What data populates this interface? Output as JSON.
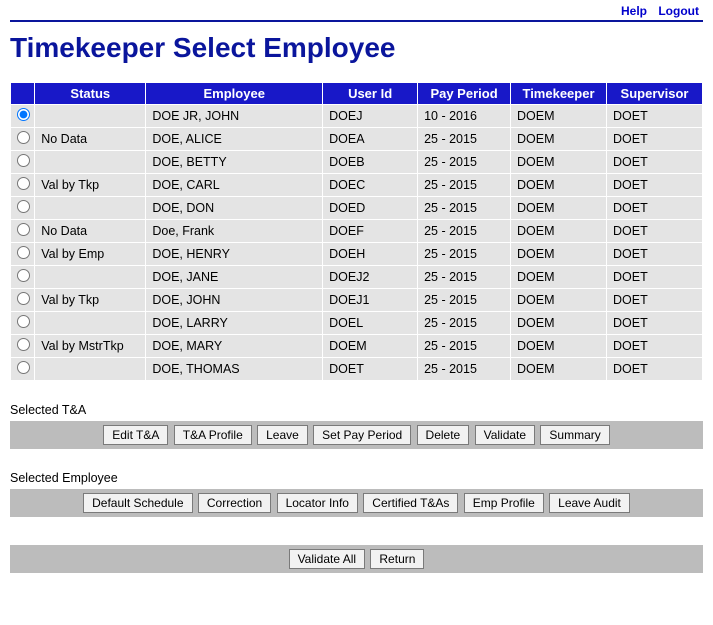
{
  "topLinks": {
    "help": "Help",
    "logout": "Logout"
  },
  "title": "Timekeeper Select Employee",
  "columns": [
    "Status",
    "Employee",
    "User Id",
    "Pay Period",
    "Timekeeper",
    "Supervisor"
  ],
  "rows": [
    {
      "selected": true,
      "status": "",
      "employee": "DOE JR, JOHN",
      "userId": "DOEJ",
      "payPeriod": "10 - 2016",
      "timekeeper": "DOEM",
      "supervisor": "DOET"
    },
    {
      "selected": false,
      "status": "No Data",
      "employee": "DOE, ALICE",
      "userId": "DOEA",
      "payPeriod": "25 - 2015",
      "timekeeper": "DOEM",
      "supervisor": "DOET"
    },
    {
      "selected": false,
      "status": "",
      "employee": "DOE, BETTY",
      "userId": "DOEB",
      "payPeriod": "25 - 2015",
      "timekeeper": "DOEM",
      "supervisor": "DOET"
    },
    {
      "selected": false,
      "status": "Val by Tkp",
      "employee": "DOE, CARL",
      "userId": "DOEC",
      "payPeriod": "25 - 2015",
      "timekeeper": "DOEM",
      "supervisor": "DOET"
    },
    {
      "selected": false,
      "status": "",
      "employee": "DOE, DON",
      "userId": "DOED",
      "payPeriod": "25 - 2015",
      "timekeeper": "DOEM",
      "supervisor": "DOET"
    },
    {
      "selected": false,
      "status": "No Data",
      "employee": "Doe, Frank",
      "userId": "DOEF",
      "payPeriod": "25 - 2015",
      "timekeeper": "DOEM",
      "supervisor": "DOET"
    },
    {
      "selected": false,
      "status": "Val by Emp",
      "employee": "DOE, HENRY",
      "userId": "DOEH",
      "payPeriod": "25 - 2015",
      "timekeeper": "DOEM",
      "supervisor": "DOET"
    },
    {
      "selected": false,
      "status": "",
      "employee": "DOE, JANE",
      "userId": "DOEJ2",
      "payPeriod": "25 - 2015",
      "timekeeper": "DOEM",
      "supervisor": "DOET"
    },
    {
      "selected": false,
      "status": "Val by Tkp",
      "employee": "DOE, JOHN",
      "userId": "DOEJ1",
      "payPeriod": "25 - 2015",
      "timekeeper": "DOEM",
      "supervisor": "DOET"
    },
    {
      "selected": false,
      "status": "",
      "employee": "DOE, LARRY",
      "userId": "DOEL",
      "payPeriod": "25 - 2015",
      "timekeeper": "DOEM",
      "supervisor": "DOET"
    },
    {
      "selected": false,
      "status": "Val by MstrTkp",
      "employee": "DOE, MARY",
      "userId": "DOEM",
      "payPeriod": "25 - 2015",
      "timekeeper": "DOEM",
      "supervisor": "DOET"
    },
    {
      "selected": false,
      "status": "",
      "employee": "DOE, THOMAS",
      "userId": "DOET",
      "payPeriod": "25 - 2015",
      "timekeeper": "DOEM",
      "supervisor": "DOET"
    }
  ],
  "sections": {
    "ta": {
      "label": "Selected T&A",
      "buttons": [
        "Edit T&A",
        "T&A Profile",
        "Leave",
        "Set Pay Period",
        "Delete",
        "Validate",
        "Summary"
      ]
    },
    "emp": {
      "label": "Selected Employee",
      "buttons": [
        "Default Schedule",
        "Correction",
        "Locator Info",
        "Certified T&As",
        "Emp Profile",
        "Leave Audit"
      ]
    },
    "final": {
      "buttons": [
        "Validate All",
        "Return"
      ]
    }
  }
}
